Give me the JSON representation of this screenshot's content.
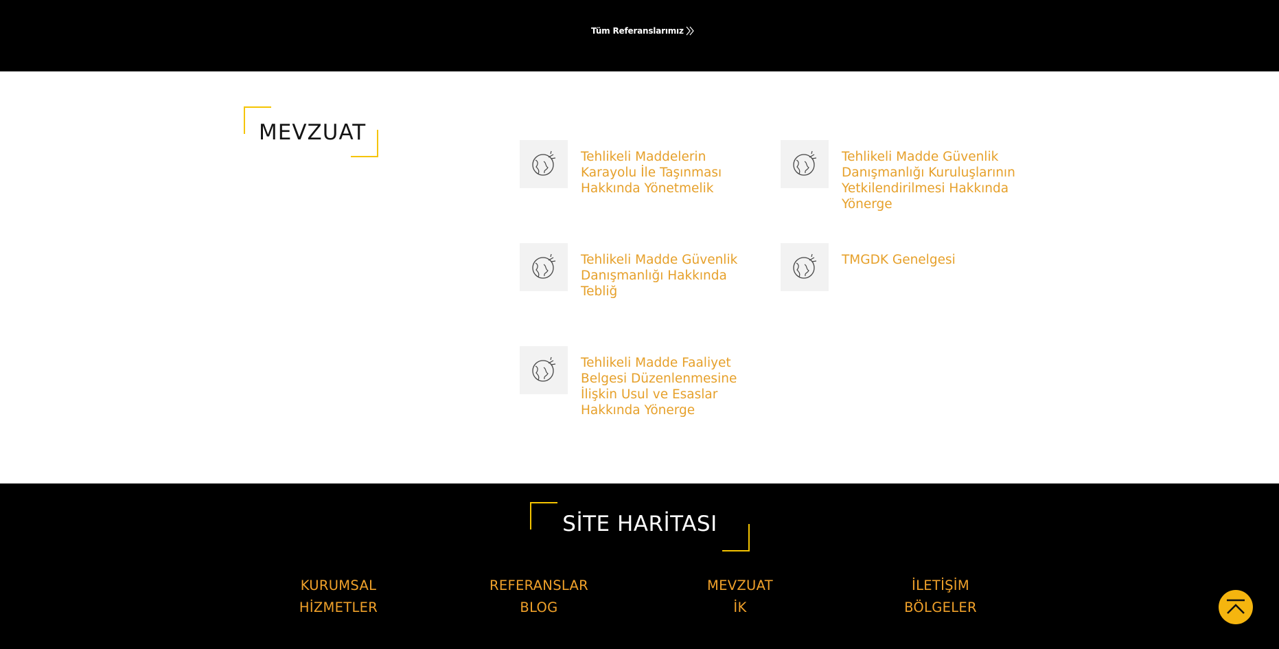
{
  "header": {
    "all_references_link": "Tüm Referanslarımız"
  },
  "mevzuat": {
    "title": "MEVZUAT",
    "items": [
      {
        "label": "Tehlikeli Maddelerin Karayolu İle Taşınması Hakkında Yönetmelik",
        "icon": "globe-icon"
      },
      {
        "label": "Tehlikeli Madde Güvenlik Danışmanlığı Kuruluşlarının Yetkilendirilmesi Hakkında Yönerge",
        "icon": "globe-icon"
      },
      {
        "label": "Tehlikeli Madde Güvenlik Danışmanlığı Hakkında Tebliğ",
        "icon": "globe-icon"
      },
      {
        "label": "TMGDK Genelgesi",
        "icon": "globe-icon"
      },
      {
        "label": "Tehlikeli Madde Faaliyet Belgesi Düzenlenmesine İlişkin Usul ve Esaslar Hakkında Yönerge",
        "icon": "globe-icon"
      }
    ]
  },
  "footer": {
    "sitemap_title": "SİTE HARİTASI",
    "columns": [
      [
        "KURUMSAL",
        "HİZMETLER"
      ],
      [
        "REFERANSLAR",
        "BLOG"
      ],
      [
        "MEVZUAT",
        "İK"
      ],
      [
        "İLETİŞİM",
        "BÖLGELER"
      ]
    ]
  },
  "scroll_top": {
    "icon": "arrow-up-to-top-icon"
  },
  "colors": {
    "accent_yellow": "#f5c400",
    "link_orange": "#e6a02a",
    "dark_band": "#000000"
  }
}
